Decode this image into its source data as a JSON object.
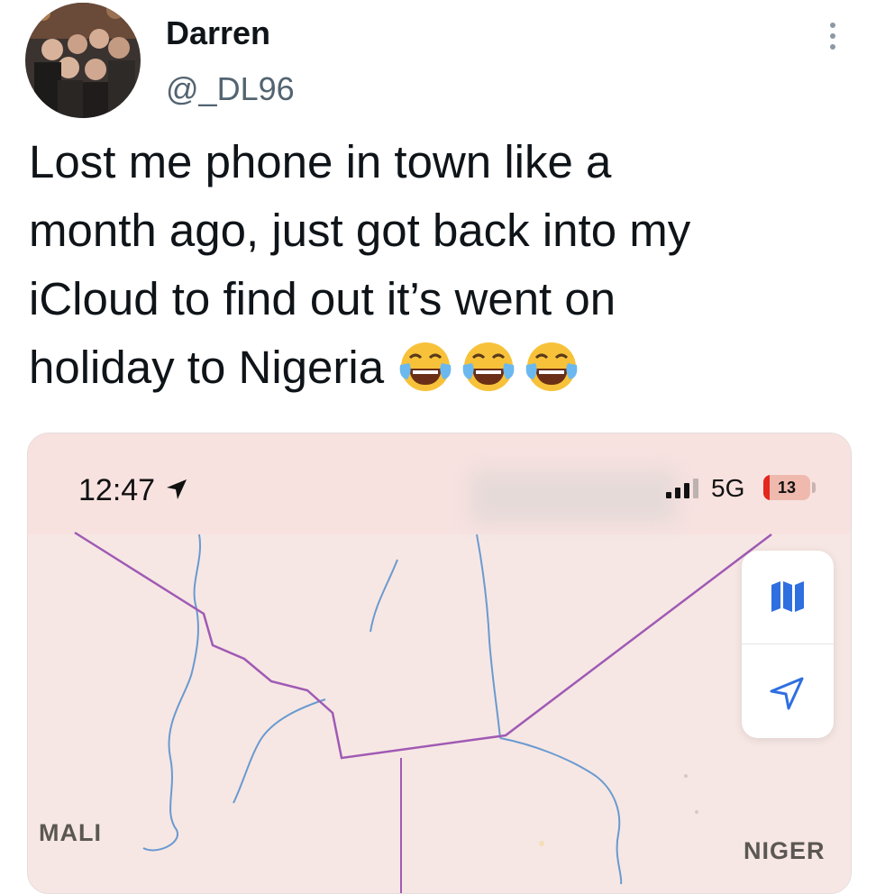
{
  "tweet": {
    "author": {
      "display_name": "Darren",
      "handle": "@_DL96",
      "avatar_icon": "group-photo-avatar"
    },
    "text": "Lost me phone in town like a\nmonth ago, just got back into my\niCloud to find out it’s went on\nholiday to Nigeria",
    "emoji": [
      "face-with-tears-of-joy",
      "face-with-tears-of-joy",
      "face-with-tears-of-joy"
    ],
    "more_icon": "more-options-icon"
  },
  "screenshot": {
    "status_bar": {
      "time": "12:47",
      "location_icon": "location-arrow-icon",
      "signal_icon": "cellular-signal-icon",
      "network": "5G",
      "battery_level": 13,
      "battery_label": "13",
      "battery_color": "#e3261e"
    },
    "map": {
      "labels": {
        "left": "MALI",
        "right": "NIGER"
      },
      "controls": [
        {
          "icon": "map-view-icon"
        },
        {
          "icon": "current-location-icon"
        }
      ],
      "colors": {
        "land": "#f6e7e4",
        "border": "#a05ab4",
        "river": "#6a9ad0"
      }
    }
  }
}
